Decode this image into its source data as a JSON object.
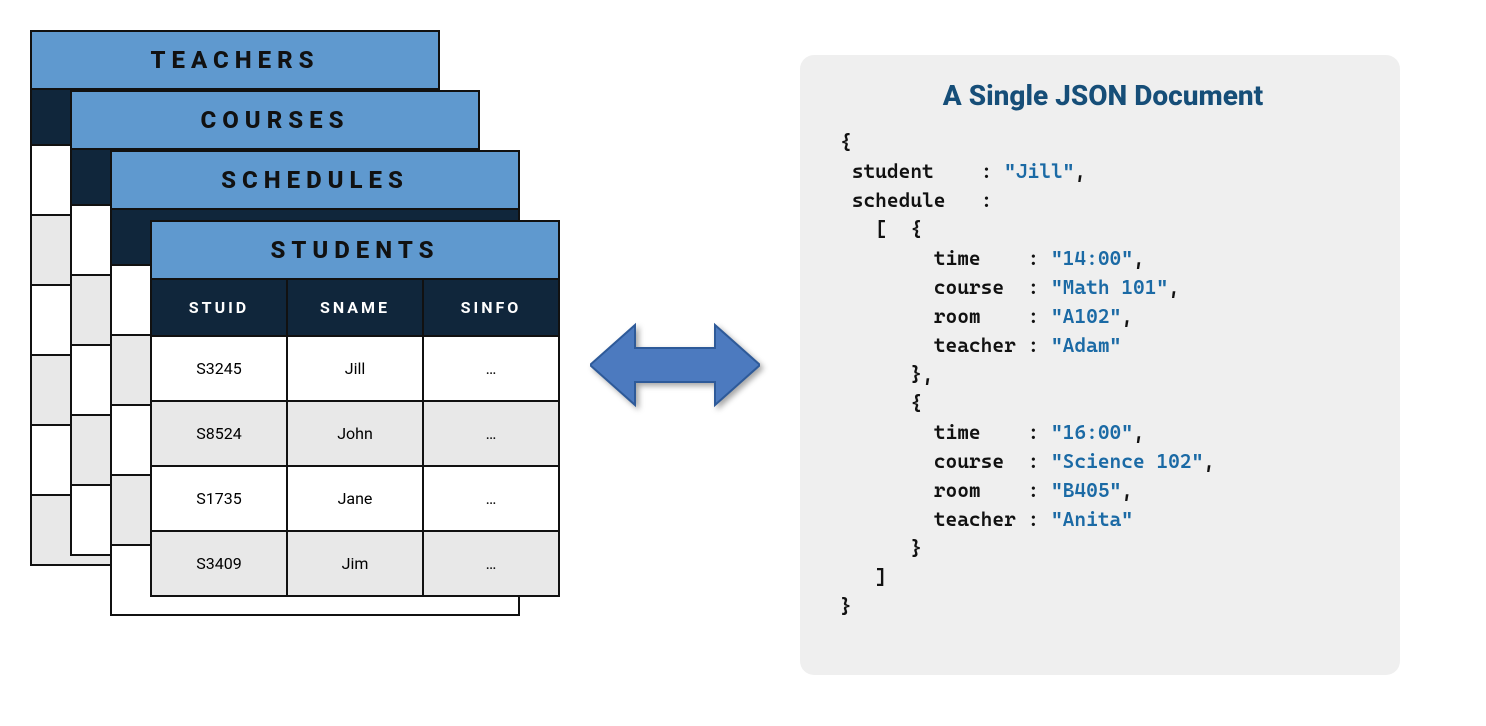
{
  "tables": {
    "teachers": {
      "title": "TEACHERS"
    },
    "courses": {
      "title": "COURSES"
    },
    "schedules": {
      "title": "SCHEDULES"
    },
    "students": {
      "title": "STUDENTS",
      "columns": [
        "STUID",
        "SNAME",
        "SINFO"
      ],
      "rows": [
        [
          "S3245",
          "Jill",
          "…"
        ],
        [
          "S8524",
          "John",
          "…"
        ],
        [
          "S1735",
          "Jane",
          "…"
        ],
        [
          "S3409",
          "Jim",
          "…"
        ]
      ]
    }
  },
  "json_panel": {
    "title": "A Single JSON Document",
    "document": {
      "student": "Jill",
      "schedule": [
        {
          "time": "14:00",
          "course": "Math 101",
          "room": "A102",
          "teacher": "Adam"
        },
        {
          "time": "16:00",
          "course": "Science 102",
          "room": "B405",
          "teacher": "Anita"
        }
      ]
    }
  },
  "colors": {
    "table_header": "#5f99cf",
    "table_cols": "#10263b",
    "arrow_fill": "#4c7abf",
    "arrow_stroke": "#2e5a99",
    "panel_bg": "#efefef",
    "json_accent": "#1b6aa5"
  }
}
